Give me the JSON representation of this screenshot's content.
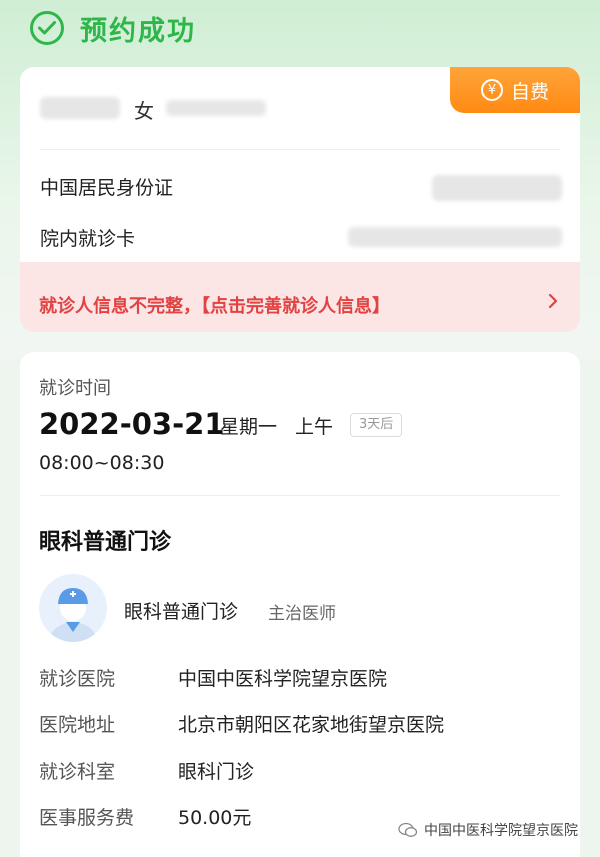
{
  "header": {
    "title": "预约成功"
  },
  "patient": {
    "gender": "女",
    "id_type_label": "中国居民身份证",
    "card_label": "院内就诊卡",
    "badge_label": "自费",
    "badge_icon": "yen-icon"
  },
  "warning": {
    "text": "就诊人信息不完整，【点击完善就诊人信息】"
  },
  "appointment": {
    "time_label": "就诊时间",
    "date": "2022-03-21",
    "weekday": "星期一",
    "period": "上午",
    "days_until": "3天后",
    "time_range": "08:00~08:30",
    "department": "眼科普通门诊",
    "doctor_name": "眼科普通门诊",
    "doctor_title": "主治医师",
    "info": [
      {
        "label": "就诊医院",
        "value": "中国中医科学院望京医院"
      },
      {
        "label": "医院地址",
        "value": "北京市朝阳区花家地街望京医院"
      },
      {
        "label": "就诊科室",
        "value": "眼科门诊"
      },
      {
        "label": "医事服务费",
        "value": "50.00元"
      }
    ]
  },
  "watermark": {
    "text": "中国中医科学院望京医院"
  },
  "colors": {
    "success": "#2fb64b",
    "warning": "#e24242",
    "badge": "#ff8a12"
  }
}
